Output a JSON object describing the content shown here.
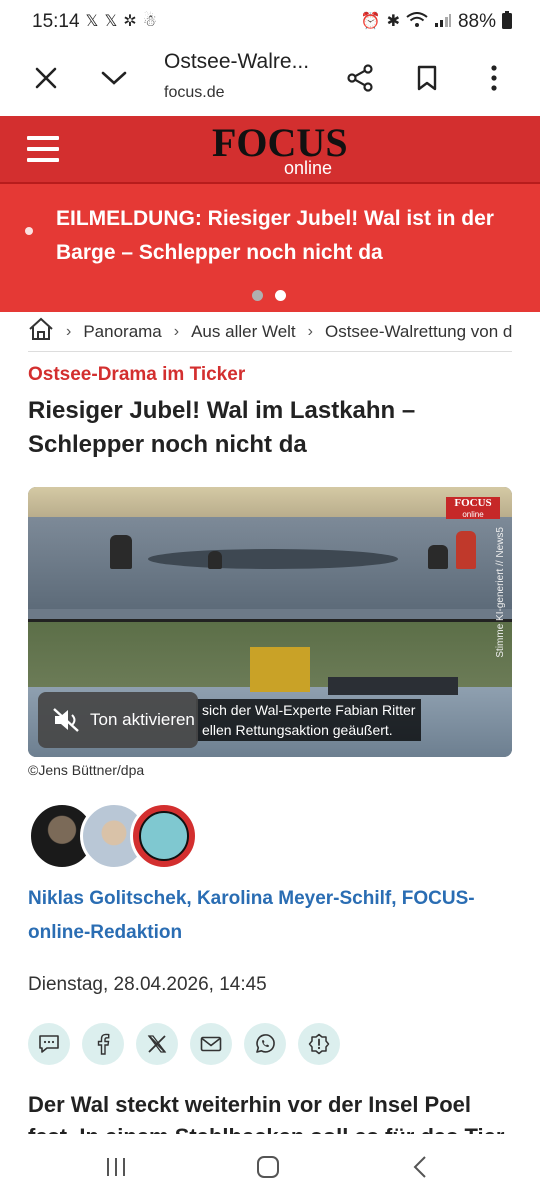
{
  "status_bar": {
    "time": "15:14",
    "battery": "88%"
  },
  "browser": {
    "title": "Ostsee-Walre...",
    "domain": "focus.de"
  },
  "header": {
    "logo_text": "FOCUS",
    "logo_sub": "online"
  },
  "breaking": {
    "text": "EILMELDUNG: Riesiger Jubel! Wal ist in der Barge – Schlepper noch nicht da",
    "pages": 2,
    "active_page": 2
  },
  "breadcrumb": {
    "items": [
      "Panorama",
      "Aus aller Welt",
      "Ostsee-Walrettung von d"
    ]
  },
  "article": {
    "kicker": "Ostsee-Drama im Ticker",
    "headline": "Riesiger Jubel! Wal im Lastkahn – Schlepper noch nicht da",
    "video": {
      "logo_top": "FOCUS",
      "logo_bottom": "online",
      "side_text": "Stimme KI-generiert // News5",
      "subtitle_line1": "sich der Wal-Experte Fabian Ritter",
      "subtitle_line2": "ellen Rettungsaktion geäußert.",
      "sound_label": "Ton aktivieren"
    },
    "photo_credit": "©Jens Büttner/dpa",
    "authors": "Niklas Golitschek, Karolina Meyer-Schilf, FOCUS-online-Redaktion",
    "date": "Dienstag, 28.04.2026, 14:45",
    "lead": "Der Wal steckt weiterhin vor der Insel Poel",
    "lead_cut": "fest. In einem Stahlbecken soll es für das Tier"
  },
  "colors": {
    "focus_red": "#d32f2f",
    "breaking_red": "#e53935",
    "author_blue": "#2a6db3",
    "share_bg": "#dcefee"
  }
}
